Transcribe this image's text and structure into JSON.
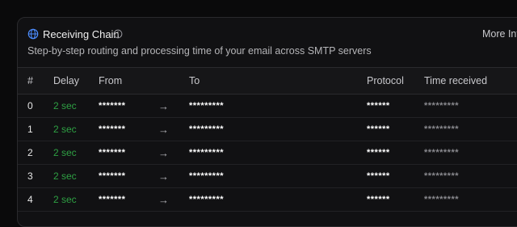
{
  "header": {
    "title": "Receiving Chain",
    "subtitle": "Step-by-step routing and processing time of your email across SMTP servers",
    "more_info": "More Inf",
    "globe_icon": "globe-icon",
    "info_icon": "info-circle-icon",
    "globe_color": "#4c8dff"
  },
  "table": {
    "columns": [
      "#",
      "Delay",
      "From",
      "",
      "To",
      "Protocol",
      "Time received"
    ],
    "rows": [
      {
        "idx": "0",
        "delay": "2 sec",
        "from": "*******",
        "arrow": "→",
        "to": "*********",
        "protocol": "******",
        "time": "*********"
      },
      {
        "idx": "1",
        "delay": "2 sec",
        "from": "*******",
        "arrow": "→",
        "to": "*********",
        "protocol": "******",
        "time": "*********"
      },
      {
        "idx": "2",
        "delay": "2 sec",
        "from": "*******",
        "arrow": "→",
        "to": "*********",
        "protocol": "******",
        "time": "*********"
      },
      {
        "idx": "3",
        "delay": "2 sec",
        "from": "*******",
        "arrow": "→",
        "to": "*********",
        "protocol": "******",
        "time": "*********"
      },
      {
        "idx": "4",
        "delay": "2 sec",
        "from": "*******",
        "arrow": "→",
        "to": "*********",
        "protocol": "******",
        "time": "*********"
      }
    ]
  },
  "colors": {
    "delay": "#2ea043",
    "background": "#0a0a0b",
    "card": "#111113"
  }
}
